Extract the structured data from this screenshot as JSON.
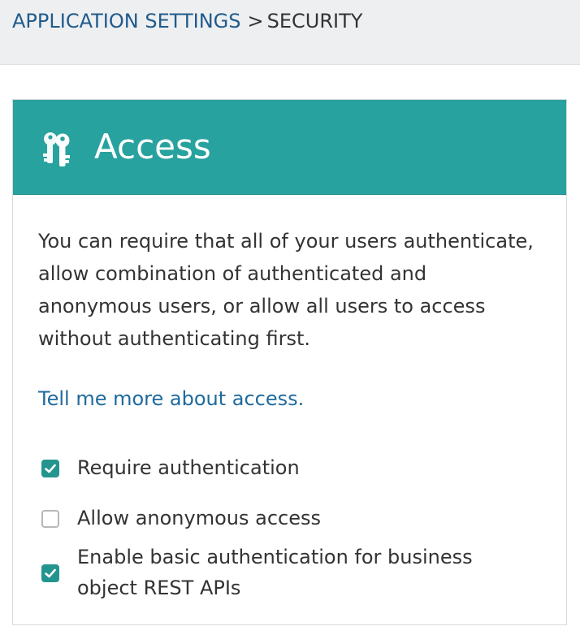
{
  "breadcrumb": {
    "parent_label": "APPLICATION SETTINGS",
    "separator": ">",
    "current_label": "SECURITY"
  },
  "panel": {
    "icon": "keys-icon",
    "title": "Access",
    "header_color": "#28a29e",
    "description": "You can require that all of your users authenticate, allow combination of authenticated and anonymous users, or allow all users to access without authenticating first.",
    "learn_more_link": "Tell me more about access."
  },
  "options": [
    {
      "label": "Require authentication",
      "checked": true
    },
    {
      "label": "Allow anonymous access",
      "checked": false
    },
    {
      "label": "Enable basic authentication for business object REST APIs",
      "checked": true
    }
  ],
  "colors": {
    "accent": "#28a29e",
    "link": "#1f5b8c",
    "text": "#333333"
  }
}
